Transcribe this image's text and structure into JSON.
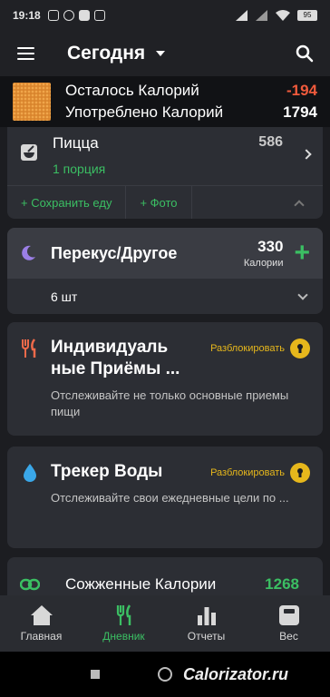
{
  "statusbar": {
    "time": "19:18",
    "battery": "95"
  },
  "appbar": {
    "title": "Сегодня"
  },
  "summary": {
    "remaining_label": "Осталось Калорий",
    "remaining_value": "-194",
    "consumed_label": "Употреблено Калорий",
    "consumed_value": "1794"
  },
  "pizza": {
    "name": "Пицца",
    "portion": "1 порция",
    "kcal": "586",
    "save_food": "+ Сохранить еду",
    "photo": "+ Фото"
  },
  "snack": {
    "title": "Перекус/Другое",
    "kcal": "330",
    "kcal_unit": "Калории",
    "quantity": "6 шт"
  },
  "promo1": {
    "title": "Индивидуаль ные Приёмы ...",
    "unlock": "Разблокировать",
    "desc": "Отслеживайте не только основные приемы пищи"
  },
  "promo2": {
    "title": "Трекер Воды",
    "unlock": "Разблокировать",
    "desc": "Отслеживайте свои ежедневные цели по ..."
  },
  "burned": {
    "label": "Сожженные Калории",
    "value": "1268"
  },
  "nav": {
    "home": "Главная",
    "diary": "Дневник",
    "reports": "Отчеты",
    "weight": "Вес"
  },
  "watermark": "Calorizator.ru",
  "colors": {
    "accent": "#3bbf63",
    "negative": "#f05a3c",
    "gold": "#e6b71c"
  }
}
